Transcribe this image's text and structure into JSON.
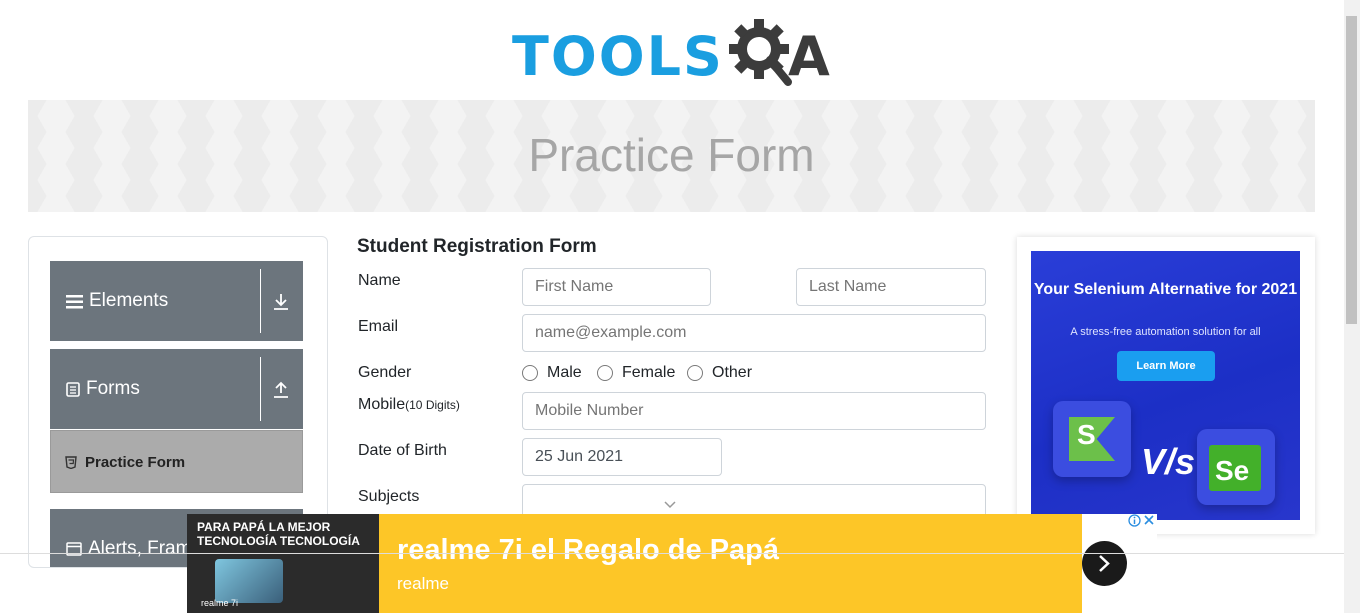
{
  "logo": {
    "text": "TOOLS",
    "text2": "A"
  },
  "banner": {
    "title": "Practice Form"
  },
  "sidebar": {
    "groups": [
      {
        "label": "Elements",
        "icon": "list-icon",
        "arrow": "download-icon"
      },
      {
        "label": "Forms",
        "icon": "document-icon",
        "arrow": "upload-icon"
      },
      {
        "label": "Alerts, Frame & Windows",
        "icon": "window-icon"
      }
    ],
    "items": [
      {
        "label": "Practice Form",
        "icon": "html5-icon"
      }
    ]
  },
  "form": {
    "title": "Student Registration Form",
    "name_label": "Name",
    "first_name_placeholder": "First Name",
    "last_name_placeholder": "Last Name",
    "email_label": "Email",
    "email_placeholder": "name@example.com",
    "gender_label": "Gender",
    "gender_options": [
      "Male",
      "Female",
      "Other"
    ],
    "mobile_label": "Mobile",
    "mobile_hint": "(10 Digits)",
    "mobile_placeholder": "Mobile Number",
    "dob_label": "Date of Birth",
    "dob_value": "25 Jun 2021",
    "subjects_label": "Subjects"
  },
  "right_ad": {
    "headline": "Your Selenium Alternative for 2021",
    "subtext": "A stress-free automation solution for all",
    "button": "Learn More",
    "vs": "V/s",
    "logo_left": "S",
    "logo_right": "Se"
  },
  "bottom_ad": {
    "image_text": "PARA PAPÁ LA MEJOR TECNOLOGÍA TECNOLOGÍA",
    "image_brand": "realme 7i",
    "title": "realme 7i el Regalo de Papá",
    "brand": "realme"
  },
  "colors": {
    "accent": "#1a9ee0",
    "sidebar": "#6c757d",
    "ad_yellow": "#fdc627",
    "ad_blue": "#2a3ed8"
  }
}
